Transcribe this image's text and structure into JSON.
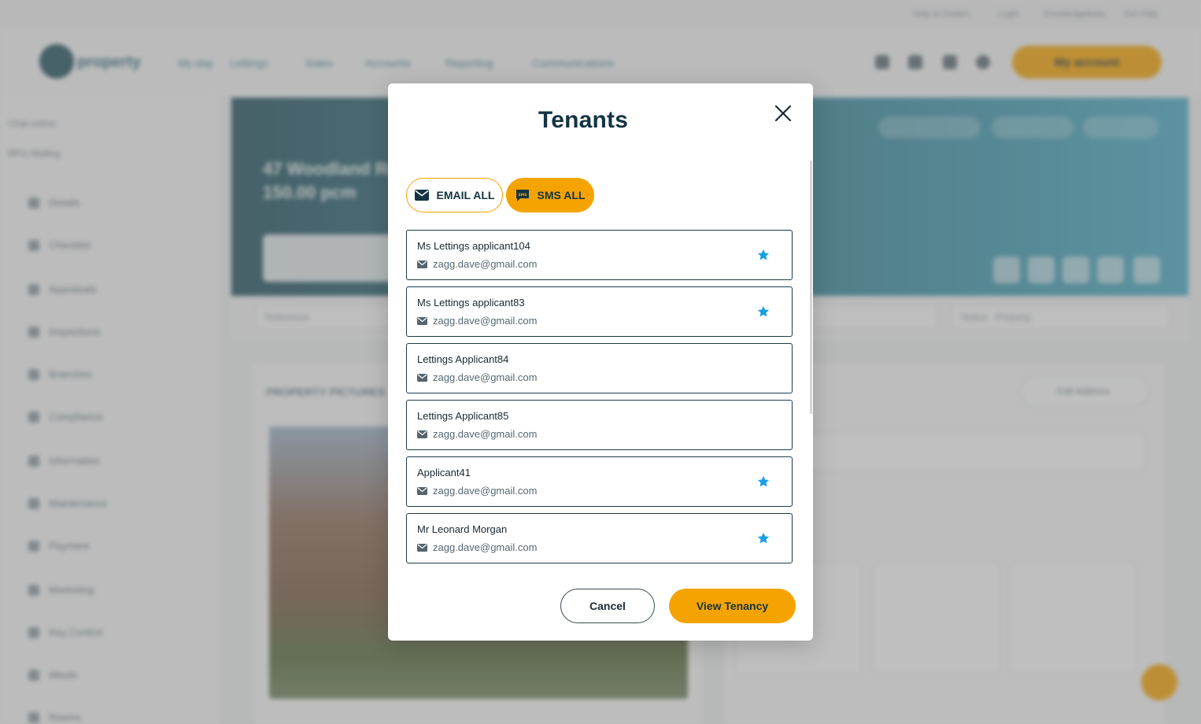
{
  "background": {
    "top_links": [
      "Help & Guides",
      "Login",
      "Knowledgebase",
      "Get Help"
    ],
    "logo_text": "property",
    "nav": [
      "My day",
      "Lettings",
      "Sales",
      "Accounts",
      "Reporting",
      "Communications"
    ],
    "account_button": "My account",
    "sidebar_top": [
      "Chat online",
      "BPG Mailing"
    ],
    "sidebar_items": [
      "Details",
      "Checklist",
      "Appraisals",
      "Inspections",
      "Branches",
      "Compliance",
      "Information",
      "Maintenance",
      "Payment",
      "Marketing",
      "Key Control",
      "Waste",
      "Rooms"
    ],
    "banner_title_line1": "47 Woodland Road",
    "banner_title_line2": "150.00 pcm",
    "filter_reference": "Reference",
    "filter_status_label": "Status",
    "filter_status_value": "Property",
    "section_photos": "PROPERTY PICTURES",
    "address_button": "Edit Address"
  },
  "modal": {
    "title": "Tenants",
    "email_all_label": "EMAIL ALL",
    "sms_all_label": "SMS ALL",
    "sms_icon_text": "SMS",
    "tenants": [
      {
        "name": "Ms Lettings applicant104",
        "email": "zagg.dave@gmail.com",
        "starred": true
      },
      {
        "name": "Ms Lettings applicant83",
        "email": "zagg.dave@gmail.com",
        "starred": true
      },
      {
        "name": "Lettings Applicant84",
        "email": "zagg.dave@gmail.com",
        "starred": false
      },
      {
        "name": "Lettings Applicant85",
        "email": "zagg.dave@gmail.com",
        "starred": false
      },
      {
        "name": "Applicant41",
        "email": "zagg.dave@gmail.com",
        "starred": true
      },
      {
        "name": "Mr Leonard Morgan",
        "email": "zagg.dave@gmail.com",
        "starred": true
      }
    ],
    "cancel_label": "Cancel",
    "view_tenancy_label": "View Tenancy"
  },
  "colors": {
    "accent": "#f5a300",
    "navy": "#143442",
    "star": "#1a9fe0",
    "card_border": "#1d3b4a"
  }
}
